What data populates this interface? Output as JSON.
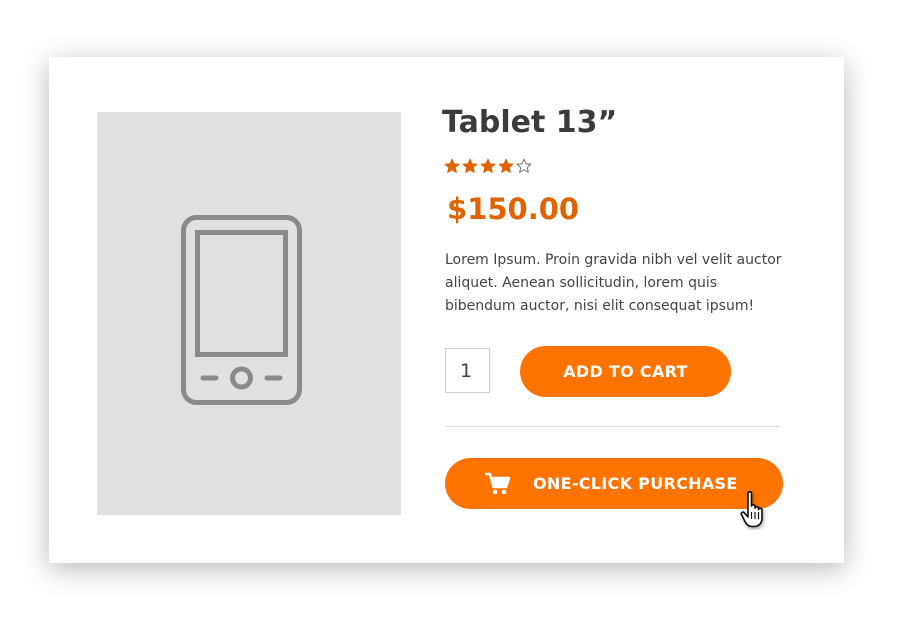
{
  "product": {
    "title": "Tablet 13”",
    "rating": 4,
    "rating_max": 5,
    "price": "$150.00",
    "description": "Lorem Ipsum. Proin gravida nibh vel velit auctor aliquet. Aenean sollicitudin, lorem quis bibendum auctor, nisi elit consequat ipsum!",
    "image_icon": "tablet-icon"
  },
  "purchase": {
    "quantity": "1",
    "add_to_cart_label": "ADD TO CART",
    "one_click_label": "ONE-CLICK PURCHASE",
    "one_click_icon": "cart-icon",
    "cursor_icon": "hand-pointer-icon"
  },
  "colors": {
    "accent": "#ff7400",
    "price": "#e06300",
    "star": "#e06300",
    "image_bg": "#e0e0e0",
    "text": "#3b3b3b"
  }
}
